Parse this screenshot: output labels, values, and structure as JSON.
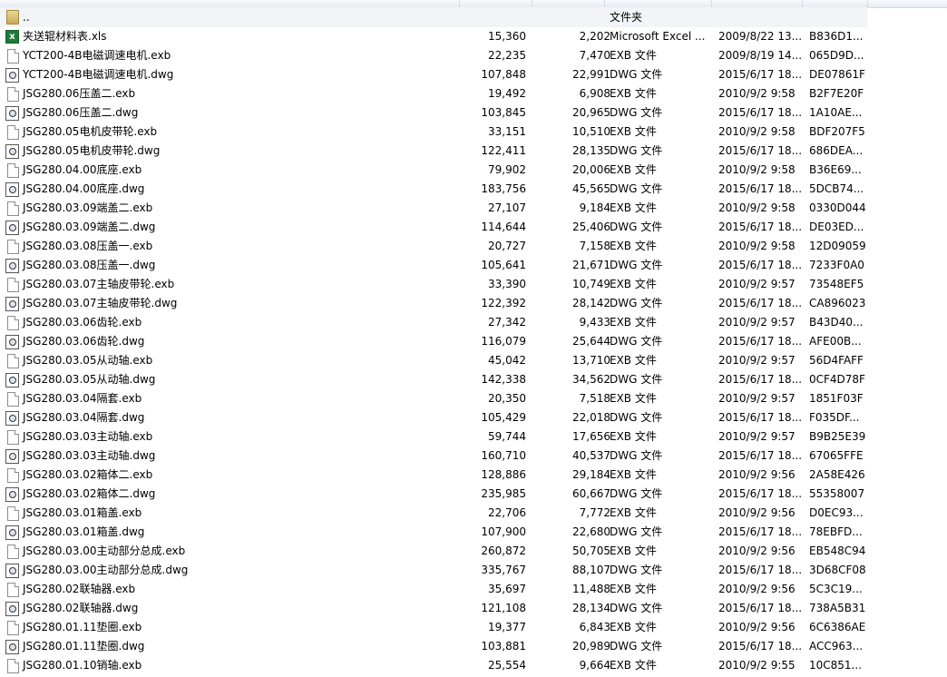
{
  "parent_row": {
    "name": "..",
    "type": "文件夹",
    "icon": "folder-icon"
  },
  "files": [
    {
      "name": "夹送辊材料表.xls",
      "size": "15,360",
      "packed": "2,202",
      "type": "Microsoft Excel ...",
      "date": "2009/8/22 13...",
      "crc": "B836D1...",
      "icon": "excel-icon"
    },
    {
      "name": "YCT200-4B电磁调速电机.exb",
      "size": "22,235",
      "packed": "7,470",
      "type": "EXB 文件",
      "date": "2009/8/19 14...",
      "crc": "065D9D...",
      "icon": "exb-file-icon"
    },
    {
      "name": "YCT200-4B电磁调速电机.dwg",
      "size": "107,848",
      "packed": "22,991",
      "type": "DWG 文件",
      "date": "2015/6/17 18...",
      "crc": "DE07861F",
      "icon": "dwg-file-icon"
    },
    {
      "name": "JSG280.06压盖二.exb",
      "size": "19,492",
      "packed": "6,908",
      "type": "EXB 文件",
      "date": "2010/9/2 9:58",
      "crc": "B2F7E20F",
      "icon": "exb-file-icon"
    },
    {
      "name": "JSG280.06压盖二.dwg",
      "size": "103,845",
      "packed": "20,965",
      "type": "DWG 文件",
      "date": "2015/6/17 18...",
      "crc": "1A10AE...",
      "icon": "dwg-file-icon"
    },
    {
      "name": "JSG280.05电机皮带轮.exb",
      "size": "33,151",
      "packed": "10,510",
      "type": "EXB 文件",
      "date": "2010/9/2 9:58",
      "crc": "BDF207F5",
      "icon": "exb-file-icon"
    },
    {
      "name": "JSG280.05电机皮带轮.dwg",
      "size": "122,411",
      "packed": "28,135",
      "type": "DWG 文件",
      "date": "2015/6/17 18...",
      "crc": "686DEA...",
      "icon": "dwg-file-icon"
    },
    {
      "name": "JSG280.04.00底座.exb",
      "size": "79,902",
      "packed": "20,006",
      "type": "EXB 文件",
      "date": "2010/9/2 9:58",
      "crc": "B36E69...",
      "icon": "exb-file-icon"
    },
    {
      "name": "JSG280.04.00底座.dwg",
      "size": "183,756",
      "packed": "45,565",
      "type": "DWG 文件",
      "date": "2015/6/17 18...",
      "crc": "5DCB74...",
      "icon": "dwg-file-icon"
    },
    {
      "name": "JSG280.03.09端盖二.exb",
      "size": "27,107",
      "packed": "9,184",
      "type": "EXB 文件",
      "date": "2010/9/2 9:58",
      "crc": "0330D044",
      "icon": "exb-file-icon"
    },
    {
      "name": "JSG280.03.09端盖二.dwg",
      "size": "114,644",
      "packed": "25,406",
      "type": "DWG 文件",
      "date": "2015/6/17 18...",
      "crc": "DE03ED...",
      "icon": "dwg-file-icon"
    },
    {
      "name": "JSG280.03.08压盖一.exb",
      "size": "20,727",
      "packed": "7,158",
      "type": "EXB 文件",
      "date": "2010/9/2 9:58",
      "crc": "12D09059",
      "icon": "exb-file-icon"
    },
    {
      "name": "JSG280.03.08压盖一.dwg",
      "size": "105,641",
      "packed": "21,671",
      "type": "DWG 文件",
      "date": "2015/6/17 18...",
      "crc": "7233F0A0",
      "icon": "dwg-file-icon"
    },
    {
      "name": "JSG280.03.07主轴皮带轮.exb",
      "size": "33,390",
      "packed": "10,749",
      "type": "EXB 文件",
      "date": "2010/9/2 9:57",
      "crc": "73548EF5",
      "icon": "exb-file-icon"
    },
    {
      "name": "JSG280.03.07主轴皮带轮.dwg",
      "size": "122,392",
      "packed": "28,142",
      "type": "DWG 文件",
      "date": "2015/6/17 18...",
      "crc": "CA896023",
      "icon": "dwg-file-icon"
    },
    {
      "name": "JSG280.03.06齿轮.exb",
      "size": "27,342",
      "packed": "9,433",
      "type": "EXB 文件",
      "date": "2010/9/2 9:57",
      "crc": "B43D40...",
      "icon": "exb-file-icon"
    },
    {
      "name": "JSG280.03.06齿轮.dwg",
      "size": "116,079",
      "packed": "25,644",
      "type": "DWG 文件",
      "date": "2015/6/17 18...",
      "crc": "AFE00B...",
      "icon": "dwg-file-icon"
    },
    {
      "name": "JSG280.03.05从动轴.exb",
      "size": "45,042",
      "packed": "13,710",
      "type": "EXB 文件",
      "date": "2010/9/2 9:57",
      "crc": "56D4FAFF",
      "icon": "exb-file-icon"
    },
    {
      "name": "JSG280.03.05从动轴.dwg",
      "size": "142,338",
      "packed": "34,562",
      "type": "DWG 文件",
      "date": "2015/6/17 18...",
      "crc": "0CF4D78F",
      "icon": "dwg-file-icon"
    },
    {
      "name": "JSG280.03.04隔套.exb",
      "size": "20,350",
      "packed": "7,518",
      "type": "EXB 文件",
      "date": "2010/9/2 9:57",
      "crc": "1851F03F",
      "icon": "exb-file-icon"
    },
    {
      "name": "JSG280.03.04隔套.dwg",
      "size": "105,429",
      "packed": "22,018",
      "type": "DWG 文件",
      "date": "2015/6/17 18...",
      "crc": "F035DF...",
      "icon": "dwg-file-icon"
    },
    {
      "name": "JSG280.03.03主动轴.exb",
      "size": "59,744",
      "packed": "17,656",
      "type": "EXB 文件",
      "date": "2010/9/2 9:57",
      "crc": "B9B25E39",
      "icon": "exb-file-icon"
    },
    {
      "name": "JSG280.03.03主动轴.dwg",
      "size": "160,710",
      "packed": "40,537",
      "type": "DWG 文件",
      "date": "2015/6/17 18...",
      "crc": "67065FFE",
      "icon": "dwg-file-icon"
    },
    {
      "name": "JSG280.03.02箱体二.exb",
      "size": "128,886",
      "packed": "29,184",
      "type": "EXB 文件",
      "date": "2010/9/2 9:56",
      "crc": "2A58E426",
      "icon": "exb-file-icon"
    },
    {
      "name": "JSG280.03.02箱体二.dwg",
      "size": "235,985",
      "packed": "60,667",
      "type": "DWG 文件",
      "date": "2015/6/17 18...",
      "crc": "55358007",
      "icon": "dwg-file-icon"
    },
    {
      "name": "JSG280.03.01箱盖.exb",
      "size": "22,706",
      "packed": "7,772",
      "type": "EXB 文件",
      "date": "2010/9/2 9:56",
      "crc": "D0EC93...",
      "icon": "exb-file-icon"
    },
    {
      "name": "JSG280.03.01箱盖.dwg",
      "size": "107,900",
      "packed": "22,680",
      "type": "DWG 文件",
      "date": "2015/6/17 18...",
      "crc": "78EBFD...",
      "icon": "dwg-file-icon"
    },
    {
      "name": "JSG280.03.00主动部分总成.exb",
      "size": "260,872",
      "packed": "50,705",
      "type": "EXB 文件",
      "date": "2010/9/2 9:56",
      "crc": "EB548C94",
      "icon": "exb-file-icon"
    },
    {
      "name": "JSG280.03.00主动部分总成.dwg",
      "size": "335,767",
      "packed": "88,107",
      "type": "DWG 文件",
      "date": "2015/6/17 18...",
      "crc": "3D68CF08",
      "icon": "dwg-file-icon"
    },
    {
      "name": "JSG280.02联轴器.exb",
      "size": "35,697",
      "packed": "11,488",
      "type": "EXB 文件",
      "date": "2010/9/2 9:56",
      "crc": "5C3C19...",
      "icon": "exb-file-icon"
    },
    {
      "name": "JSG280.02联轴器.dwg",
      "size": "121,108",
      "packed": "28,134",
      "type": "DWG 文件",
      "date": "2015/6/17 18...",
      "crc": "738A5B31",
      "icon": "dwg-file-icon"
    },
    {
      "name": "JSG280.01.11垫圈.exb",
      "size": "19,377",
      "packed": "6,843",
      "type": "EXB 文件",
      "date": "2010/9/2 9:56",
      "crc": "6C6386AE",
      "icon": "exb-file-icon"
    },
    {
      "name": "JSG280.01.11垫圈.dwg",
      "size": "103,881",
      "packed": "20,989",
      "type": "DWG 文件",
      "date": "2015/6/17 18...",
      "crc": "ACC963...",
      "icon": "dwg-file-icon"
    },
    {
      "name": "JSG280.01.10销轴.exb",
      "size": "25,554",
      "packed": "9,664",
      "type": "EXB 文件",
      "date": "2010/9/2 9:55",
      "crc": "10C851...",
      "icon": "exb-file-icon"
    }
  ]
}
